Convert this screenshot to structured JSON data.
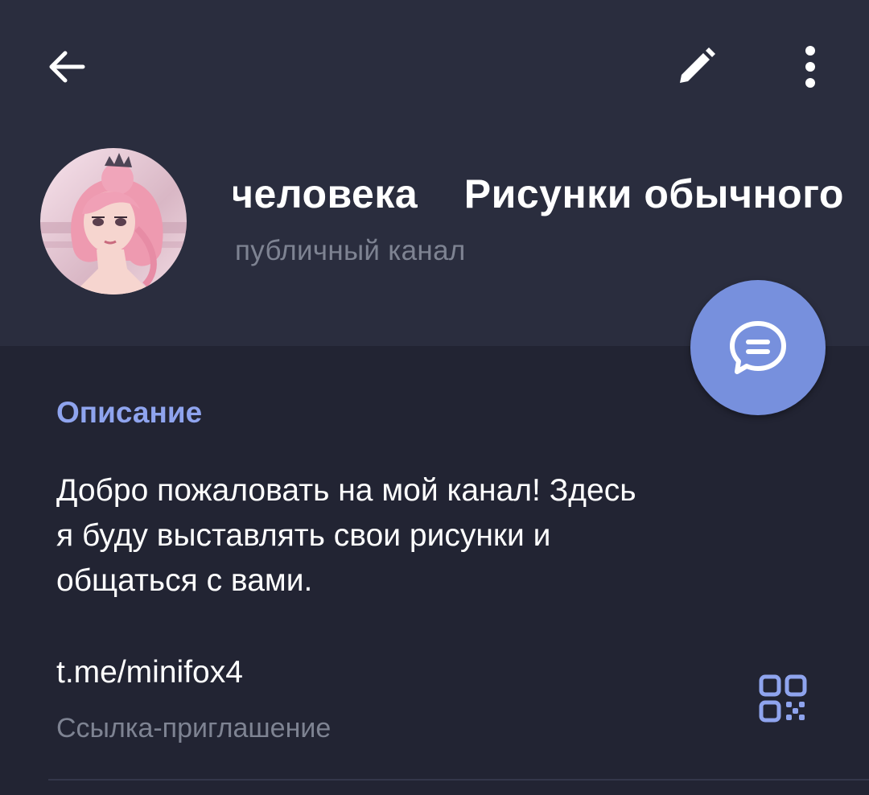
{
  "colors": {
    "header_bg": "#2A2D3E",
    "page_bg": "#222433",
    "accent": "#8FA4EE",
    "fab": "#7790DD",
    "secondary_text": "#7E8392"
  },
  "toolbar": {
    "back_icon": "arrow-left-icon",
    "edit_icon": "pencil-icon",
    "more_icon": "more-vertical-icon"
  },
  "channel": {
    "title": "человека    Рисунки обычного",
    "subtitle": "публичный канал",
    "avatar_icon": "anime-girl-avatar"
  },
  "fab": {
    "icon": "message-bubble-icon"
  },
  "info": {
    "description_heading": "Описание",
    "description_lines": [
      "Добро пожаловать на мой канал! Здесь",
      "я буду выставлять свои рисунки и",
      "общаться с вами."
    ],
    "link": "t.me/minifox4",
    "link_caption": "Ссылка-приглашение",
    "qr_icon": "qr-code-icon"
  }
}
